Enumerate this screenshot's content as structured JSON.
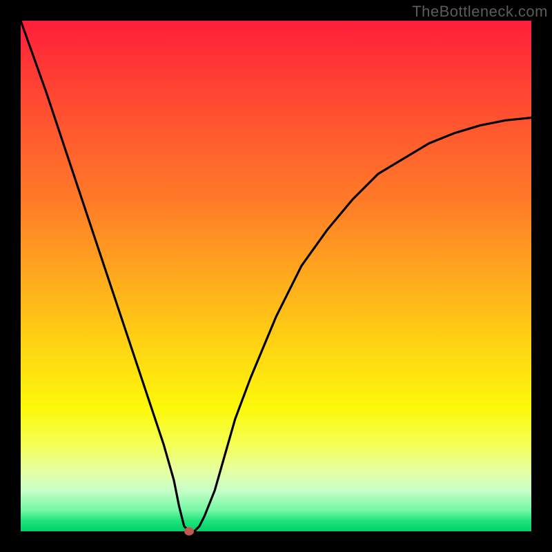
{
  "watermark": "TheBottleneck.com",
  "chart_data": {
    "type": "line",
    "title": "",
    "xlabel": "",
    "ylabel": "",
    "xlim": [
      0,
      100
    ],
    "ylim": [
      0,
      100
    ],
    "grid": false,
    "series": [
      {
        "name": "curve",
        "x": [
          0,
          5,
          10,
          15,
          20,
          25,
          28,
          30,
          31,
          32,
          33,
          34,
          35,
          36,
          38,
          40,
          42,
          45,
          50,
          55,
          60,
          65,
          70,
          75,
          80,
          85,
          90,
          95,
          100
        ],
        "y": [
          100,
          86,
          71,
          56,
          41,
          26,
          17,
          10,
          5,
          1,
          0,
          0,
          1,
          3,
          8,
          15,
          22,
          30,
          42,
          52,
          59,
          65,
          70,
          73,
          76,
          78,
          79.5,
          80.5,
          81
        ]
      }
    ],
    "marker": {
      "x": 33,
      "y": 0,
      "color": "#c1584f"
    },
    "background_gradient": [
      "#ff1f3a",
      "#ff7a28",
      "#ffcf14",
      "#fcf90a",
      "#70f7a2",
      "#00d369"
    ]
  }
}
